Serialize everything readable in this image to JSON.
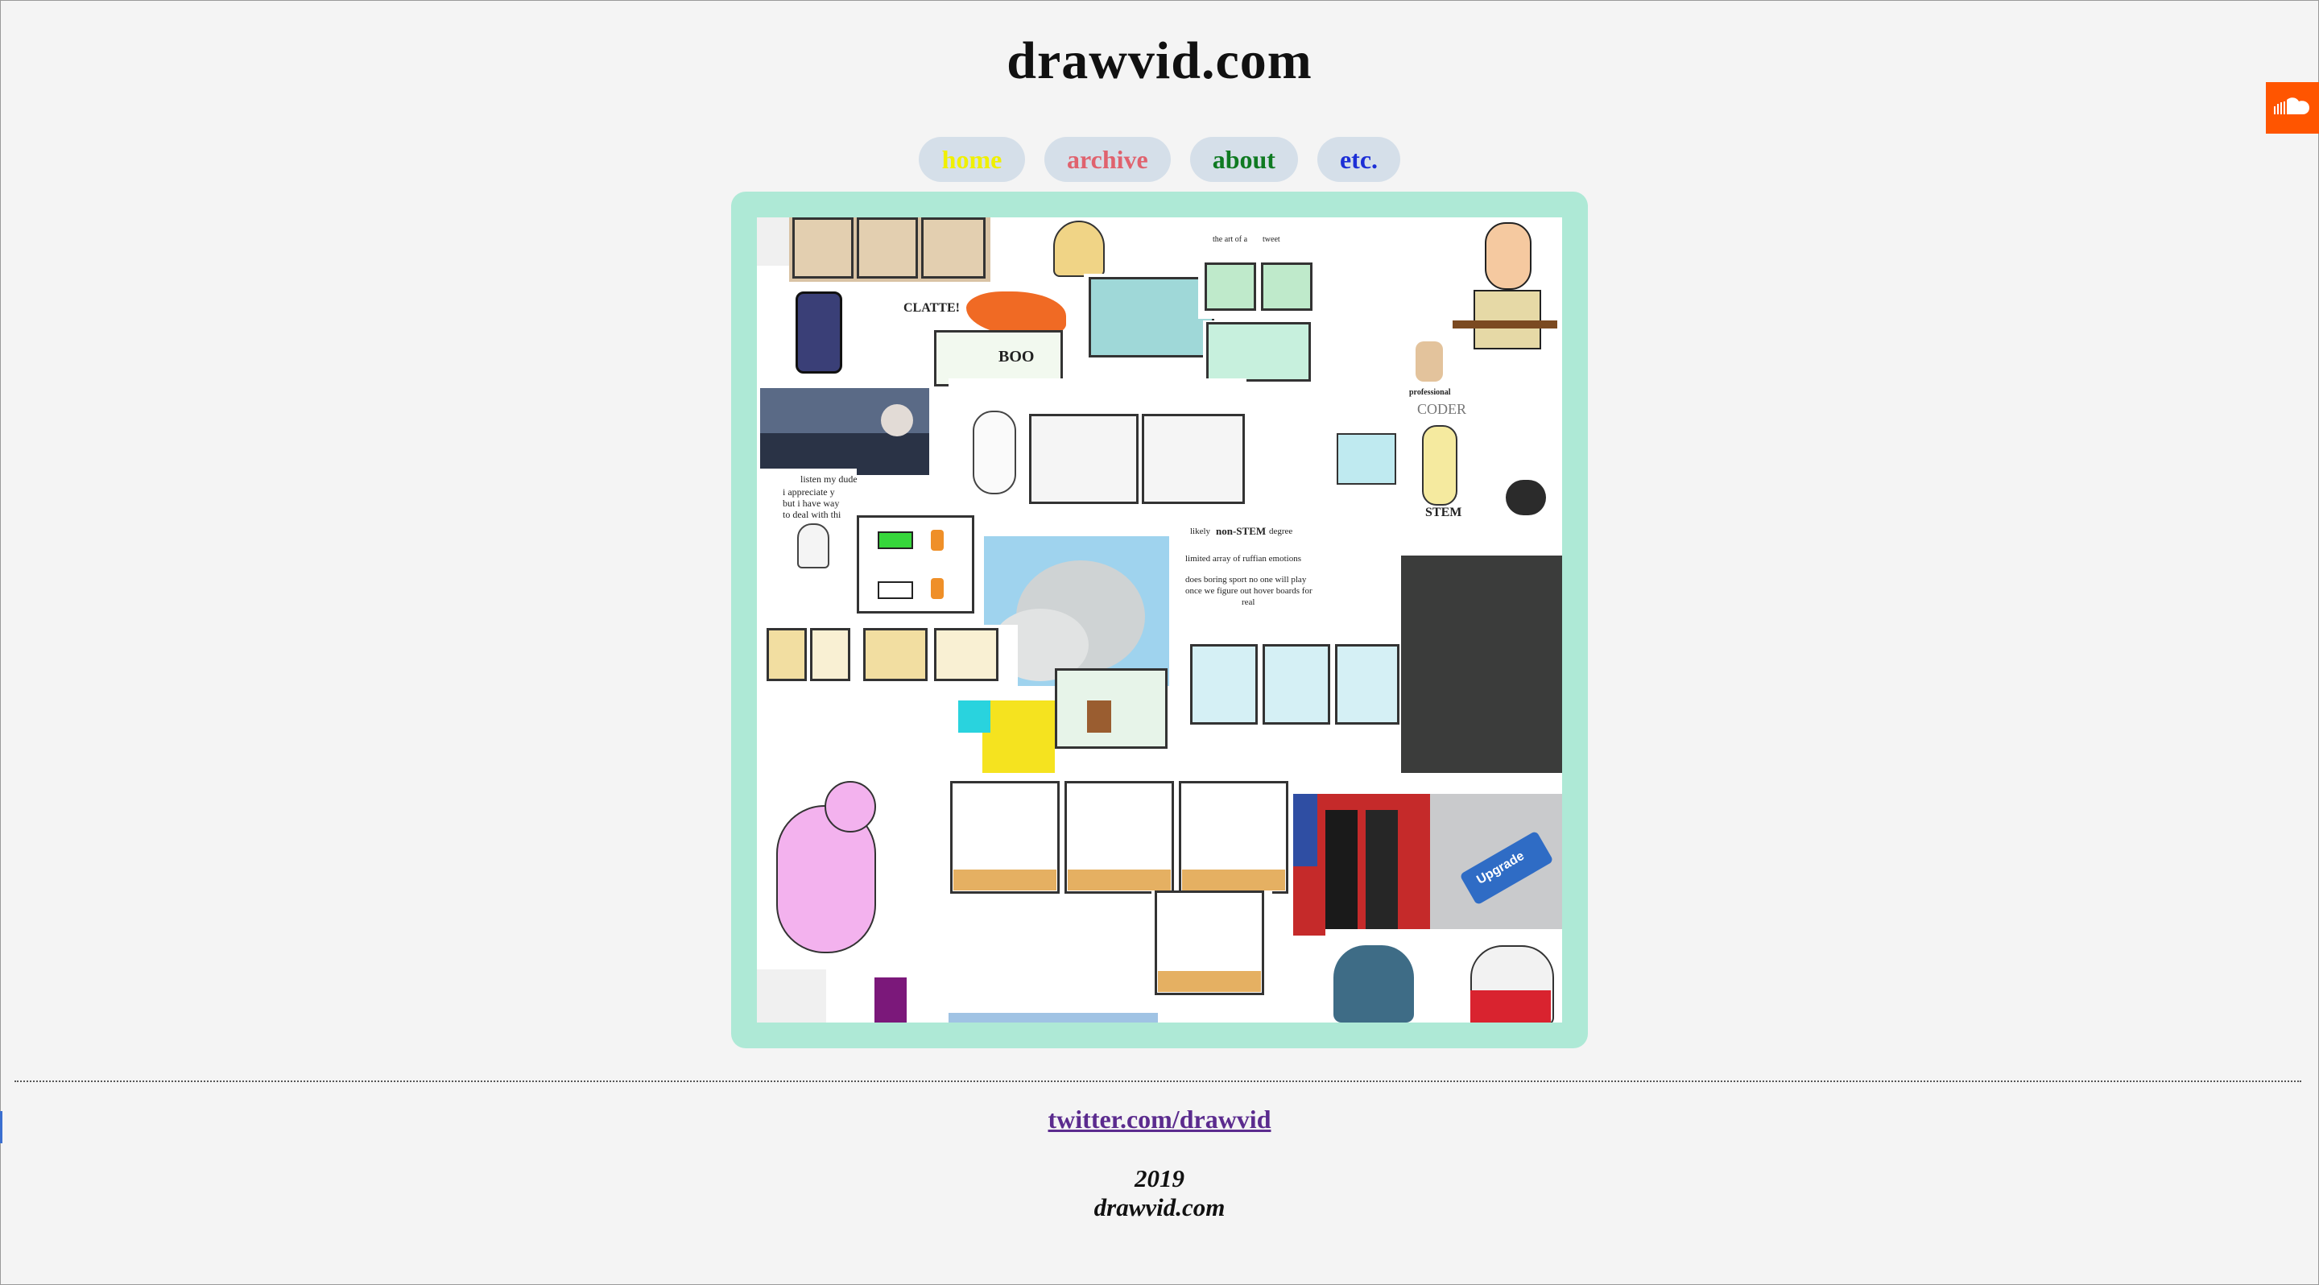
{
  "site": {
    "title": "drawvid.com"
  },
  "nav": {
    "items": [
      {
        "label": "home",
        "color": "#f0f000"
      },
      {
        "label": "archive",
        "color": "#e0626e"
      },
      {
        "label": "about",
        "color": "#0f7a22"
      },
      {
        "label": "etc.",
        "color": "#1d2fd6"
      }
    ]
  },
  "collage": {
    "frame_color": "#aee9d6",
    "text": {
      "boo": "BOO",
      "clatter": "CLATTE!",
      "professional": "professional",
      "coder": "CODER",
      "stem": "STEM",
      "likely": "likely",
      "non_stem": "non-STEM",
      "degree": "degree",
      "upgrade": "Upgrade",
      "listen": "listen my dude,",
      "appreciate": "i appreciate y",
      "have_way": "but i have way",
      "deal": "to deal with thi",
      "limited": "limited array of ruffian emotions",
      "boring": "does boring sport no one will play",
      "once": "once we figure out hover boards for",
      "real": "real",
      "art_of": "the art of a",
      "tweet": "tweet"
    }
  },
  "footer": {
    "twitter_label": "twitter.com/drawvid",
    "year": "2019",
    "site": "drawvid.com"
  },
  "widgets": {
    "soundcloud_icon": "soundcloud-icon",
    "soundcloud_color": "#ff5500"
  }
}
